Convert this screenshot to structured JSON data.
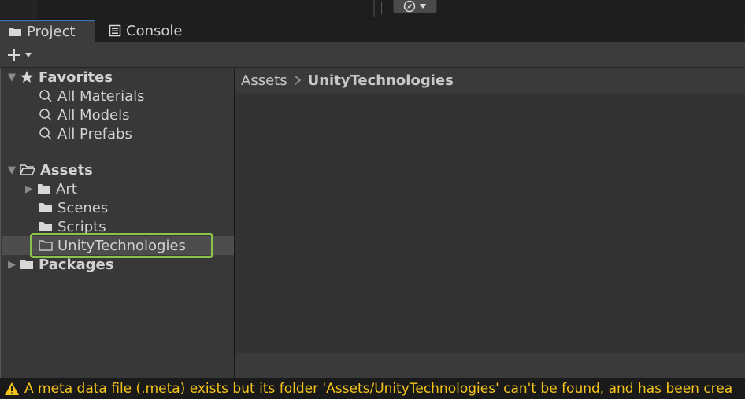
{
  "tabs": [
    {
      "label": "Project",
      "icon": "folder-icon",
      "active": true
    },
    {
      "label": "Console",
      "icon": "console-icon",
      "active": false
    }
  ],
  "toolbar": {
    "create_button": "+",
    "create_icon": "plus-icon",
    "dropdown_icon": "caret-down-icon"
  },
  "tree": {
    "favorites": {
      "label": "Favorites",
      "icon": "star-icon",
      "items": [
        {
          "label": "All Materials",
          "icon": "search-icon"
        },
        {
          "label": "All Models",
          "icon": "search-icon"
        },
        {
          "label": "All Prefabs",
          "icon": "search-icon"
        }
      ]
    },
    "assets": {
      "label": "Assets",
      "icon": "folder-open-icon",
      "items": [
        {
          "label": "Art",
          "icon": "folder-icon",
          "expandable": true
        },
        {
          "label": "Scenes",
          "icon": "folder-icon"
        },
        {
          "label": "Scripts",
          "icon": "folder-icon"
        },
        {
          "label": "UnityTechnologies",
          "icon": "folder-empty-icon",
          "selected": true
        }
      ]
    },
    "packages": {
      "label": "Packages",
      "icon": "folder-icon"
    }
  },
  "breadcrumb": {
    "root": "Assets",
    "separator": ">",
    "current": "UnityTechnologies"
  },
  "status": {
    "icon": "warning-icon",
    "message": "A meta data file (.meta) exists but its folder 'Assets/UnityTechnologies' can't be found, and has been crea"
  },
  "colors": {
    "accent_tab": "#3a79bb",
    "highlight": "#8bc34a",
    "warning": "#f5c518",
    "panel": "#383838"
  }
}
